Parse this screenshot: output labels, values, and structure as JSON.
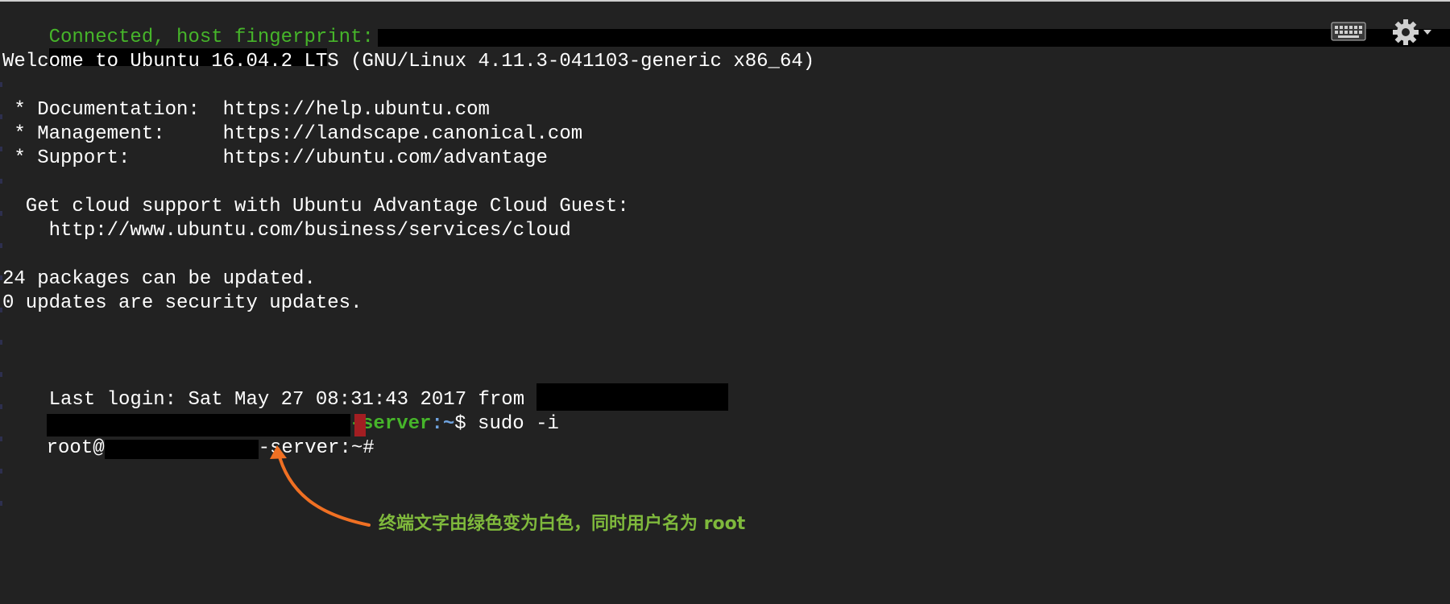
{
  "terminal": {
    "connected_text": "Connected, host fingerprint:",
    "welcome": "Welcome to Ubuntu 16.04.2 LTS (GNU/Linux 4.11.3-041103-generic x86_64)",
    "doc_line": " * Documentation:  https://help.ubuntu.com",
    "mgmt_line": " * Management:     https://landscape.canonical.com",
    "support_line": " * Support:        https://ubuntu.com/advantage",
    "cloud_line1": "  Get cloud support with Ubuntu Advantage Cloud Guest:",
    "cloud_line2": "    http://www.ubuntu.com/business/services/cloud",
    "packages_line": "24 packages can be updated.",
    "security_line": "0 updates are security updates.",
    "last_login": "Last login: Sat May 27 08:31:43 2017 from ",
    "user_prompt_host_suffix": "-server",
    "user_prompt_path": ":~",
    "user_prompt_cmd": "$ sudo -i",
    "root_prefix": "root@",
    "root_suffix": "-server:~# "
  },
  "toolbar": {
    "keyboard_icon": "keyboard-icon",
    "settings_icon": "gear-icon"
  },
  "annotation": {
    "text": "终端文字由绿色变为白色，同时用户名为 root"
  },
  "colors": {
    "background": "#222222",
    "green_text": "#46b52a",
    "path_blue": "#6fa3df",
    "cursor": "#a31e22",
    "annotation_text": "#7fb93c",
    "arrow": "#f07023"
  }
}
